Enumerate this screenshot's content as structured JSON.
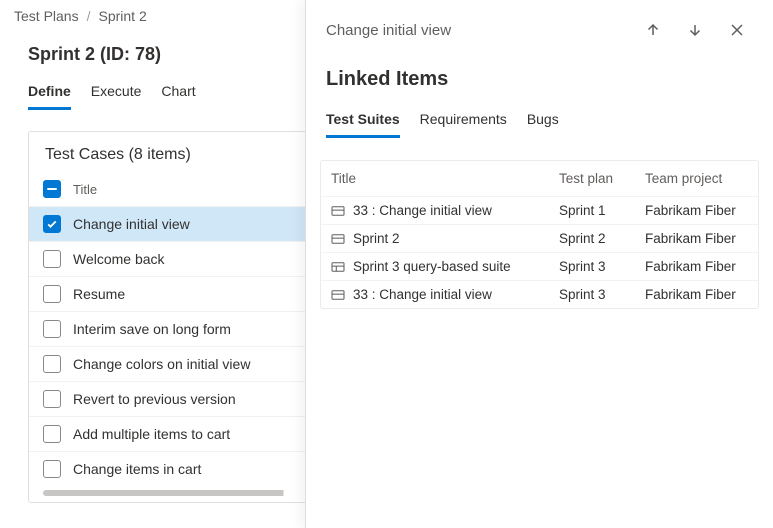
{
  "breadcrumb": {
    "root": "Test Plans",
    "current": "Sprint 2"
  },
  "page_title": "Sprint 2 (ID: 78)",
  "main_tabs": [
    {
      "label": "Define",
      "active": true
    },
    {
      "label": "Execute",
      "active": false
    },
    {
      "label": "Chart",
      "active": false
    }
  ],
  "test_cases": {
    "header": "Test Cases (8 items)",
    "column_title": "Title",
    "items": [
      {
        "title": "Change initial view",
        "checked": true,
        "selected": true
      },
      {
        "title": "Welcome back",
        "checked": false,
        "selected": false
      },
      {
        "title": "Resume",
        "checked": false,
        "selected": false
      },
      {
        "title": "Interim save on long form",
        "checked": false,
        "selected": false
      },
      {
        "title": "Change colors on initial view",
        "checked": false,
        "selected": false
      },
      {
        "title": "Revert to previous version",
        "checked": false,
        "selected": false
      },
      {
        "title": "Add multiple items to cart",
        "checked": false,
        "selected": false
      },
      {
        "title": "Change items in cart",
        "checked": false,
        "selected": false
      }
    ]
  },
  "panel": {
    "title": "Change initial view",
    "section_title": "Linked Items",
    "tabs": [
      {
        "label": "Test Suites",
        "active": true
      },
      {
        "label": "Requirements",
        "active": false
      },
      {
        "label": "Bugs",
        "active": false
      }
    ],
    "columns": {
      "title": "Title",
      "plan": "Test plan",
      "team": "Team project"
    },
    "rows": [
      {
        "icon": "static",
        "title": "33 : Change initial view",
        "plan": "Sprint 1",
        "team": "Fabrikam Fiber"
      },
      {
        "icon": "static",
        "title": "Sprint 2",
        "plan": "Sprint 2",
        "team": "Fabrikam Fiber"
      },
      {
        "icon": "query",
        "title": "Sprint 3 query-based suite",
        "plan": "Sprint 3",
        "team": "Fabrikam Fiber"
      },
      {
        "icon": "static",
        "title": "33 : Change initial view",
        "plan": "Sprint 3",
        "team": "Fabrikam Fiber"
      }
    ]
  }
}
